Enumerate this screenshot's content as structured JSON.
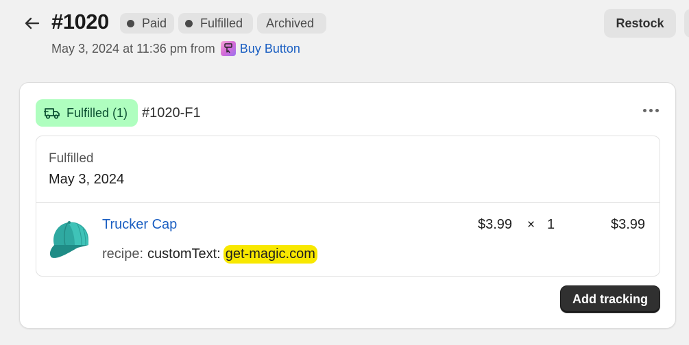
{
  "header": {
    "order_number": "#1020",
    "badges": {
      "payment": "Paid",
      "fulfillment": "Fulfilled",
      "archive": "Archived"
    },
    "date_text": "May 3, 2024 at 11:36 pm from",
    "channel_name": "Buy Button",
    "restock_label": "Restock"
  },
  "fulfillment_card": {
    "status_label": "Fulfilled (1)",
    "fulfillment_id": "#1020-F1",
    "status_text": "Fulfilled",
    "date": "May 3, 2024",
    "line_item": {
      "product_name": "Trucker Cap",
      "property_key": "recipe:",
      "property_value_prefix": "customText:",
      "property_value": "get-magic.com",
      "unit_price": "$3.99",
      "times_symbol": "×",
      "quantity": "1",
      "total": "$3.99"
    },
    "add_tracking_label": "Add tracking"
  },
  "icons": {
    "back": "arrow-left-icon",
    "channel": "buy-button-icon",
    "status": "delivery-truck-icon",
    "more": "more-horizontal-icon",
    "product": "trucker-cap-image"
  },
  "colors": {
    "fulfilled_pill_bg": "#affebf",
    "fulfilled_pill_text": "#0c5132",
    "link": "#1b5fc2",
    "highlight": "#f8e800",
    "primary_button": "#303030"
  }
}
